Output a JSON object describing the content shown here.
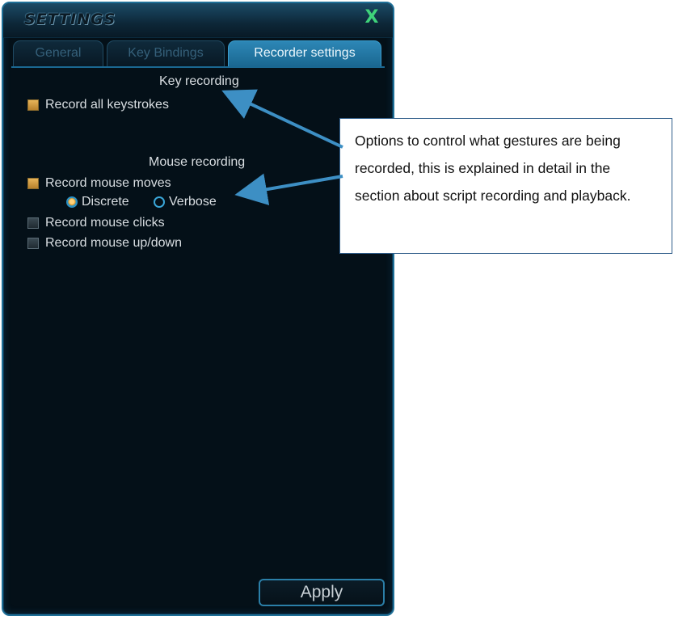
{
  "window": {
    "title": "SETTINGS",
    "close_label": "X"
  },
  "tabs": [
    {
      "label": "General",
      "active": false
    },
    {
      "label": "Key Bindings",
      "active": false
    },
    {
      "label": "Recorder settings",
      "active": true
    }
  ],
  "key_recording": {
    "heading": "Key recording",
    "options": [
      {
        "label": "Record all keystrokes",
        "checked": true
      }
    ]
  },
  "mouse_recording": {
    "heading": "Mouse recording",
    "options": [
      {
        "label": "Record mouse moves",
        "checked": true
      },
      {
        "label": "Record mouse clicks",
        "checked": false
      },
      {
        "label": "Record mouse up/down",
        "checked": false
      }
    ],
    "mode": {
      "options": [
        {
          "label": "Discrete",
          "selected": true
        },
        {
          "label": "Verbose",
          "selected": false
        }
      ]
    }
  },
  "apply_label": "Apply",
  "callout": {
    "text": "Options to control what gestures are being recorded, this is explained in detail in the section about script recording and playback."
  },
  "colors": {
    "accent": "#2d87b6",
    "checkbox_checked": "#d89a3e",
    "close": "#3fd37a",
    "arrow": "#3d8fc4"
  }
}
